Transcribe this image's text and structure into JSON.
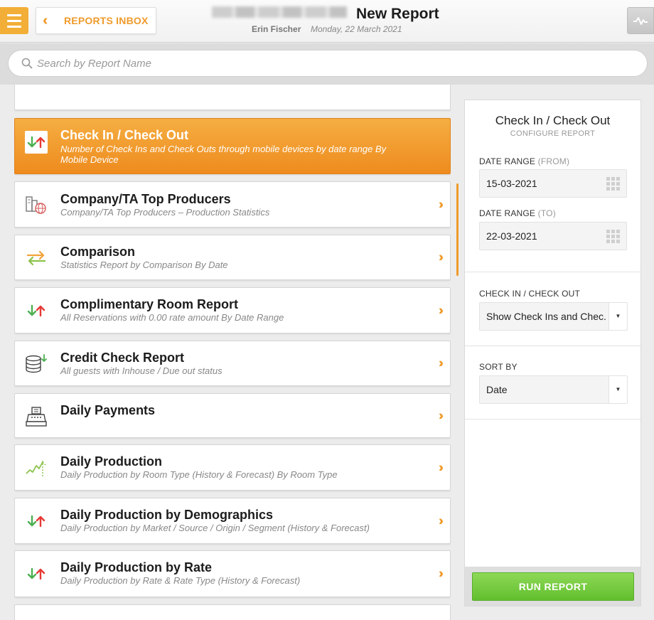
{
  "header": {
    "back_label": "REPORTS INBOX",
    "page_title": "New Report",
    "user_name": "Erin Fischer",
    "date": "Monday, 22 March 2021"
  },
  "search": {
    "placeholder": "Search by Report Name",
    "value": ""
  },
  "reports": [
    {
      "title": "Check In / Check Out",
      "desc": "Number of Check Ins and Check Outs through mobile devices by date range By Mobile Device",
      "icon": "arrows-down-up-icon",
      "active": true
    },
    {
      "title": "Company/TA Top Producers",
      "desc": "Company/TA Top Producers – Production Statistics",
      "icon": "buildings-globe-icon"
    },
    {
      "title": "Comparison",
      "desc": "Statistics Report by Comparison By Date",
      "icon": "swap-arrows-icon"
    },
    {
      "title": "Complimentary Room Report",
      "desc": "All Reservations with 0.00 rate amount By Date Range",
      "icon": "arrows-down-up-icon"
    },
    {
      "title": "Credit Check Report",
      "desc": "All guests with Inhouse / Due out status",
      "icon": "coins-icon"
    },
    {
      "title": "Daily Payments",
      "desc": "",
      "icon": "cash-register-icon"
    },
    {
      "title": "Daily Production",
      "desc": "Daily Production by Room Type (History & Forecast) By Room Type",
      "icon": "trend-chart-icon"
    },
    {
      "title": "Daily Production by Demographics",
      "desc": "Daily Production by Market / Source / Origin / Segment (History & Forecast)",
      "icon": "arrows-down-up-icon"
    },
    {
      "title": "Daily Production by Rate",
      "desc": "Daily Production by Rate & Rate Type (History & Forecast)",
      "icon": "arrows-down-up-icon"
    }
  ],
  "panel": {
    "title": "Check In / Check Out",
    "subtitle": "CONFIGURE REPORT",
    "date_from_label": "DATE RANGE",
    "date_from_suffix": "(FROM)",
    "date_from_value": "15-03-2021",
    "date_to_label": "DATE RANGE",
    "date_to_suffix": "(TO)",
    "date_to_value": "22-03-2021",
    "checkin_label": "CHECK IN / CHECK OUT",
    "checkin_value": "Show Check Ins and Chec.",
    "sort_label": "SORT BY",
    "sort_value": "Date",
    "run_label": "RUN REPORT"
  },
  "colors": {
    "accent": "#ef9b2b",
    "active_card": "#f0951f",
    "run_button": "#72c83b",
    "arrow_down": "#4caf50",
    "arrow_up": "#e53935"
  }
}
